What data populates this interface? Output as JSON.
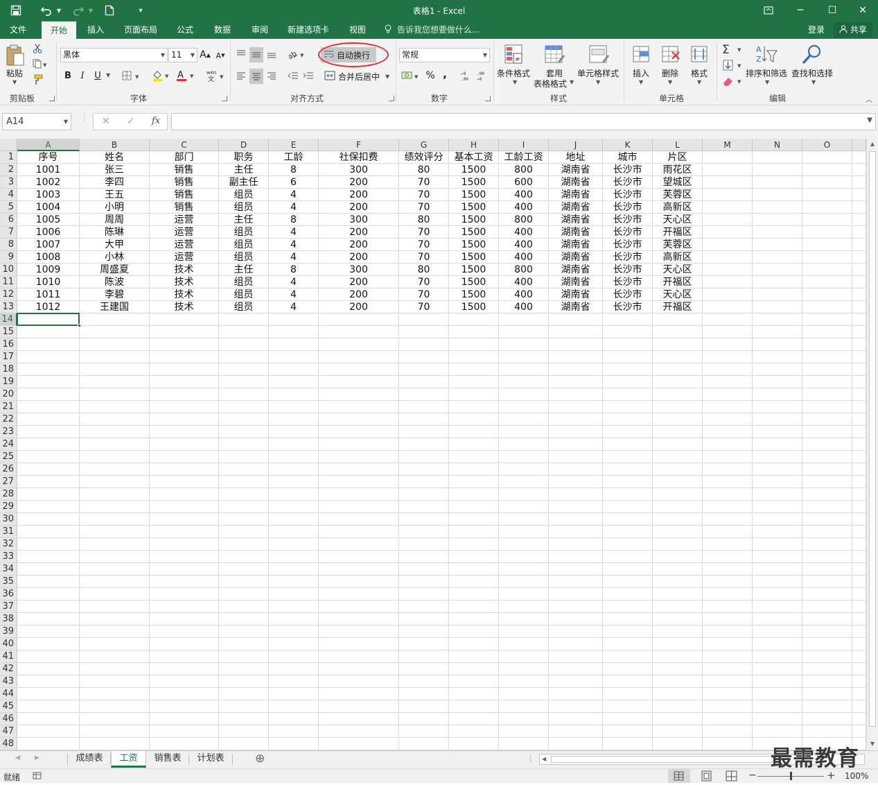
{
  "titlebar": {
    "title": "表格1 - Excel",
    "save_icon": "save-icon",
    "undo_icon": "undo-icon",
    "redo_icon": "redo-icon",
    "newdoc_icon": "new-document-icon",
    "customize_icon": "customize-qat-icon",
    "ribbon_display_icon": "ribbon-display-icon",
    "minimize": "─",
    "maximize": "☐",
    "close": "✕"
  },
  "menu": {
    "tabs": [
      "文件",
      "开始",
      "插入",
      "页面布局",
      "公式",
      "数据",
      "审阅",
      "新建选项卡",
      "视图"
    ],
    "active_tab": "开始",
    "tell_me": "告诉我您想要做什么...",
    "login": "登录",
    "share": "共享"
  },
  "ribbon": {
    "clipboard": {
      "paste": "粘贴",
      "label": "剪贴板"
    },
    "font": {
      "name": "黑体",
      "size": "11",
      "bold": "B",
      "italic": "I",
      "underline": "U",
      "font_color_glyph": "A",
      "grow": "A",
      "shrink": "A",
      "label": "字体"
    },
    "alignment": {
      "wrap_text": "自动换行",
      "merge_center": "合并后居中",
      "label": "对齐方式"
    },
    "number": {
      "format": "常规",
      "percent": "%",
      "comma": ",",
      "label": "数字"
    },
    "styles": {
      "conditional": "条件格式",
      "table_format_1": "套用",
      "table_format_2": "表格格式",
      "cell_styles": "单元格样式",
      "label": "样式"
    },
    "cells": {
      "insert": "插入",
      "delete": "删除",
      "format": "格式",
      "label": "单元格"
    },
    "editing": {
      "sort_filter": "排序和筛选",
      "find_select": "查找和选择",
      "label": "编辑"
    },
    "accent_color": "#217346",
    "highlight_color": "#e03030"
  },
  "formula_bar": {
    "name_box": "A14",
    "cancel": "✕",
    "enter": "✓",
    "fx": "fx",
    "value": ""
  },
  "sheet": {
    "columns": [
      "A",
      "B",
      "C",
      "D",
      "E",
      "F",
      "G",
      "H",
      "I",
      "J",
      "K",
      "L",
      "M",
      "N",
      "O"
    ],
    "row_count": 48,
    "selected_cell": "A14",
    "headers": [
      "序号",
      "姓名",
      "部门",
      "职务",
      "工龄",
      "社保扣费",
      "绩效评分",
      "基本工资",
      "工龄工资",
      "地址",
      "城市",
      "片区"
    ],
    "rows": [
      [
        "1001",
        "张三",
        "销售",
        "主任",
        "8",
        "300",
        "80",
        "1500",
        "800",
        "湖南省",
        "长沙市",
        "雨花区"
      ],
      [
        "1002",
        "李四",
        "销售",
        "副主任",
        "6",
        "200",
        "70",
        "1500",
        "600",
        "湖南省",
        "长沙市",
        "望城区"
      ],
      [
        "1003",
        "王五",
        "销售",
        "组员",
        "4",
        "200",
        "70",
        "1500",
        "400",
        "湖南省",
        "长沙市",
        "芙蓉区"
      ],
      [
        "1004",
        "小明",
        "销售",
        "组员",
        "4",
        "200",
        "70",
        "1500",
        "400",
        "湖南省",
        "长沙市",
        "高新区"
      ],
      [
        "1005",
        "周周",
        "运营",
        "主任",
        "8",
        "300",
        "80",
        "1500",
        "800",
        "湖南省",
        "长沙市",
        "天心区"
      ],
      [
        "1006",
        "陈琳",
        "运营",
        "组员",
        "4",
        "200",
        "70",
        "1500",
        "400",
        "湖南省",
        "长沙市",
        "开福区"
      ],
      [
        "1007",
        "大甲",
        "运营",
        "组员",
        "4",
        "200",
        "70",
        "1500",
        "400",
        "湖南省",
        "长沙市",
        "芙蓉区"
      ],
      [
        "1008",
        "小林",
        "运营",
        "组员",
        "4",
        "200",
        "70",
        "1500",
        "400",
        "湖南省",
        "长沙市",
        "高新区"
      ],
      [
        "1009",
        "周盛夏",
        "技术",
        "主任",
        "8",
        "300",
        "80",
        "1500",
        "800",
        "湖南省",
        "长沙市",
        "天心区"
      ],
      [
        "1010",
        "陈波",
        "技术",
        "组员",
        "4",
        "200",
        "70",
        "1500",
        "400",
        "湖南省",
        "长沙市",
        "开福区"
      ],
      [
        "1011",
        "李碧",
        "技术",
        "组员",
        "4",
        "200",
        "70",
        "1500",
        "400",
        "湖南省",
        "长沙市",
        "天心区"
      ],
      [
        "1012",
        "王建国",
        "技术",
        "组员",
        "4",
        "200",
        "70",
        "1500",
        "400",
        "湖南省",
        "长沙市",
        "开福区"
      ]
    ]
  },
  "sheet_tabs": {
    "tabs": [
      "成绩表",
      "工资",
      "销售表",
      "计划表"
    ],
    "active": "工资",
    "add": "⊕"
  },
  "status": {
    "ready": "就绪",
    "zoom": "100%",
    "zoom_level": 1.0
  },
  "watermark": "最需教育"
}
